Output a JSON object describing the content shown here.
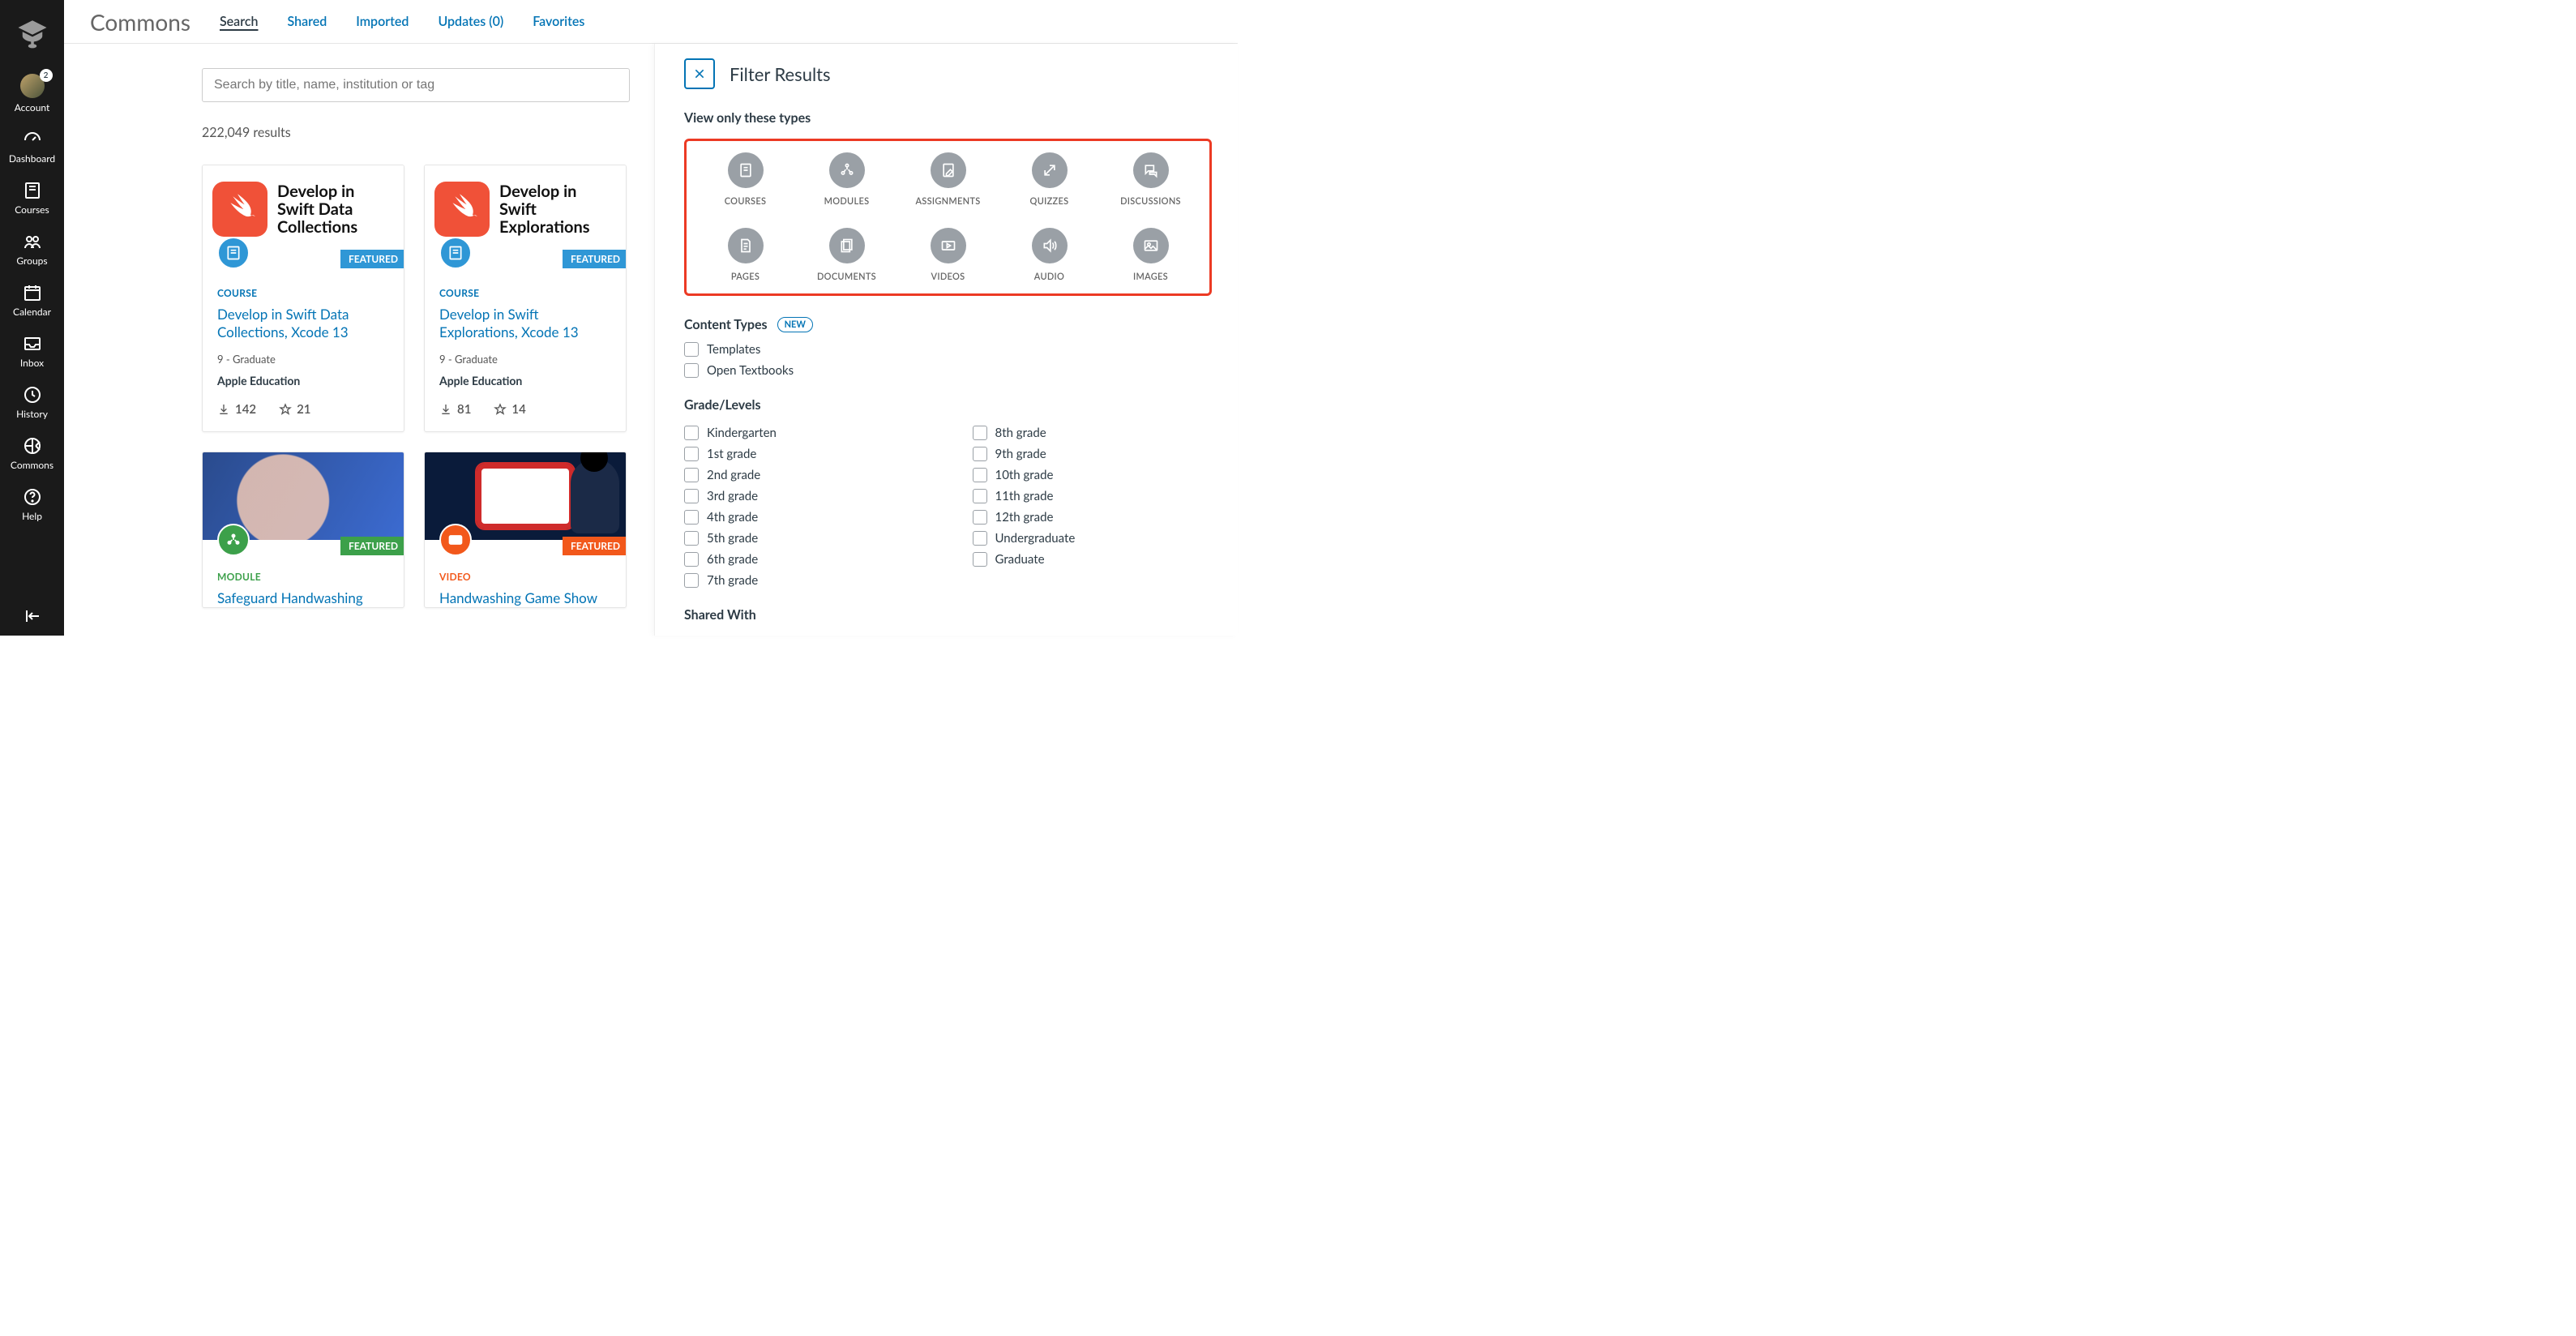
{
  "rail": {
    "badge": "2",
    "items": [
      {
        "key": "account",
        "label": "Account"
      },
      {
        "key": "dashboard",
        "label": "Dashboard"
      },
      {
        "key": "courses",
        "label": "Courses"
      },
      {
        "key": "groups",
        "label": "Groups"
      },
      {
        "key": "calendar",
        "label": "Calendar"
      },
      {
        "key": "inbox",
        "label": "Inbox"
      },
      {
        "key": "history",
        "label": "History"
      },
      {
        "key": "commons",
        "label": "Commons"
      },
      {
        "key": "help",
        "label": "Help"
      }
    ]
  },
  "header": {
    "brand": "Commons",
    "tabs": [
      "Search",
      "Shared",
      "Imported",
      "Updates (0)",
      "Favorites"
    ],
    "active_tab": 0
  },
  "search": {
    "placeholder": "Search by title, name, institution or tag",
    "value": ""
  },
  "results": {
    "count_text": "222,049 results",
    "featured_label": "FEATURED"
  },
  "cards": [
    {
      "thumb_text": "Develop in Swift Data Collections",
      "kind_key": "course",
      "kind": "COURSE",
      "title": "Develop in Swift Data Collections, Xcode 13",
      "grades": "9 - Graduate",
      "author": "Apple Education",
      "downloads": "142",
      "favorites": "21",
      "featured": true
    },
    {
      "thumb_text": "Develop in Swift Explorations",
      "kind_key": "course",
      "kind": "COURSE",
      "title": "Develop in Swift Explorations, Xcode 13",
      "grades": "9 - Graduate",
      "author": "Apple Education",
      "downloads": "81",
      "favorites": "14",
      "featured": true
    },
    {
      "kind_key": "module",
      "kind": "MODULE",
      "title": "Safeguard Handwashing",
      "featured": true
    },
    {
      "kind_key": "video",
      "kind": "VIDEO",
      "title": "Handwashing Game Show",
      "featured": true
    }
  ],
  "filter": {
    "title": "Filter Results",
    "types_heading": "View only these types",
    "types": [
      "COURSES",
      "MODULES",
      "ASSIGNMENTS",
      "QUIZZES",
      "DISCUSSIONS",
      "PAGES",
      "DOCUMENTS",
      "VIDEOS",
      "AUDIO",
      "IMAGES"
    ],
    "content_types_heading": "Content Types",
    "new_label": "NEW",
    "content_types": [
      "Templates",
      "Open Textbooks"
    ],
    "grades_heading": "Grade/Levels",
    "grades_left": [
      "Kindergarten",
      "1st grade",
      "2nd grade",
      "3rd grade",
      "4th grade",
      "5th grade",
      "6th grade",
      "7th grade"
    ],
    "grades_right": [
      "8th grade",
      "9th grade",
      "10th grade",
      "11th grade",
      "12th grade",
      "Undergraduate",
      "Graduate"
    ],
    "shared_heading": "Shared With"
  }
}
